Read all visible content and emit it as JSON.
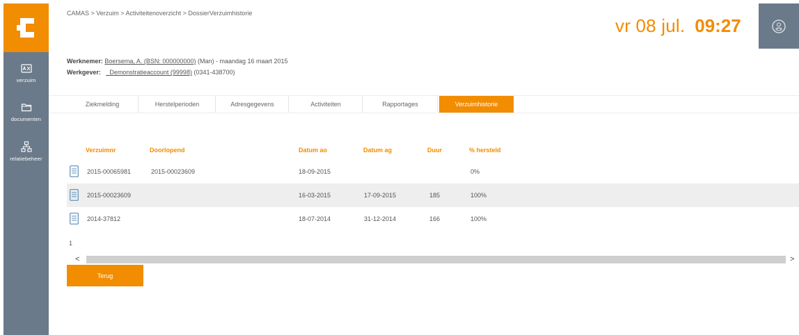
{
  "breadcrumb": "CAMAS > Verzuim > Activiteitenoverzicht > DossierVerzuimhistorie",
  "datetime": {
    "date": "vr 08 jul.",
    "time": "09:27"
  },
  "sidebar": {
    "items": [
      {
        "label": "verzuim",
        "icon": "id-card-icon"
      },
      {
        "label": "documenten",
        "icon": "folder-icon"
      },
      {
        "label": "relatiebeheer",
        "icon": "network-icon"
      }
    ]
  },
  "employee": {
    "werknemer_label": "Werknemer:",
    "werknemer_name": "Boersema, A. (BSN: 000000000)",
    "werknemer_rest": "(Man) - maandag 16 maart 2015",
    "werkgever_label": "Werkgever:",
    "werkgever_name": "_Demonstratieaccount (99998)",
    "werkgever_rest": "(0341-438700)"
  },
  "tabs": [
    {
      "label": "Ziekmelding",
      "active": false
    },
    {
      "label": "Herstelperioden",
      "active": false
    },
    {
      "label": "Adresgegevens",
      "active": false
    },
    {
      "label": "Activiteiten",
      "active": false
    },
    {
      "label": "Rapportages",
      "active": false
    },
    {
      "label": "Verzuimhistorie",
      "active": true
    }
  ],
  "table": {
    "headers": {
      "verzuimnr": "Verzuimnr",
      "doorlopend": "Doorlopend",
      "datum_ao": "Datum ao",
      "datum_ag": "Datum ag",
      "duur": "Duur",
      "hersteld": "% hersteld"
    },
    "rows": [
      {
        "verzuimnr": "2015-00065981",
        "doorlopend": "2015-00023609",
        "datum_ao": "18-09-2015",
        "datum_ag": "",
        "duur": "",
        "hersteld": "0%"
      },
      {
        "verzuimnr": "2015-00023609",
        "doorlopend": "",
        "datum_ao": "16-03-2015",
        "datum_ag": "17-09-2015",
        "duur": "185",
        "hersteld": "100%"
      },
      {
        "verzuimnr": "2014-37812",
        "doorlopend": "",
        "datum_ao": "18-07-2014",
        "datum_ag": "31-12-2014",
        "duur": "166",
        "hersteld": "100%"
      }
    ]
  },
  "pager": "1",
  "scroll": {
    "left": "<",
    "right": ">"
  },
  "buttons": {
    "terug": "Terug"
  },
  "colors": {
    "accent": "#f28c00",
    "sidebar": "#6b7a8a",
    "row_alt": "#eeeeee"
  }
}
